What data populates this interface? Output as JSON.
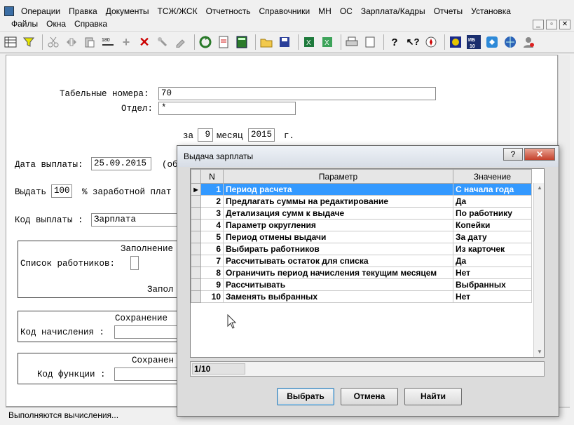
{
  "menubar": {
    "row1": [
      "Операции",
      "Правка",
      "Документы",
      "ТСЖ/ЖСК",
      "Отчетность",
      "Справочники",
      "МН",
      "ОС",
      "Зарплата/Кадры",
      "Отчеты",
      "Установка"
    ],
    "row2": [
      "Файлы",
      "Окна",
      "Справка"
    ],
    "window_controls": [
      "_",
      "▫",
      "✕"
    ]
  },
  "toolbar": {
    "icons": [
      "grid-icon",
      "filter-icon",
      "cut-icon",
      "move-icon",
      "paste-icon",
      "rotate-180-icon",
      "add-icon",
      "delete-icon",
      "tool-icon",
      "edit-icon",
      "refresh-icon",
      "export-icon",
      "calculator-icon",
      "open-folder-icon",
      "save-icon",
      "excel-icon",
      "excel-export-icon",
      "print-icon",
      "document-icon",
      "help-icon",
      "whats-this-icon",
      "compass-icon",
      "teamviewer-icon",
      "ib-icon",
      "support-icon",
      "globe-icon",
      "user-icon"
    ],
    "ib_label": "ИБ 10"
  },
  "form": {
    "tab_numbers_label": "Табельные номера:",
    "tab_numbers_value": "70",
    "department_label": "Отдел:",
    "department_value": "*",
    "period_prefix": "за",
    "month_value": "9",
    "month_label": "месяц",
    "year_value": "2015",
    "year_suffix": "г.",
    "pay_date_label": "Дата выплаты:",
    "pay_date_value": "25.09.2015",
    "pay_date_note": "(об",
    "issue_label": "Выдать",
    "issue_value": "100",
    "issue_suffix": "% заработной плат",
    "pay_code_label": "Код выплаты :",
    "pay_code_value": "Зарплата",
    "fill_group_title": "Заполнение",
    "employees_list_label": "Список работников:",
    "fill_group_footer": "Запол",
    "save_group_title": "Сохранение",
    "accrual_code_label": "Код начисления :",
    "save2_group_title": "Сохранен",
    "function_code_label": "Код функции :"
  },
  "status": {
    "text": "Выполняются вычисления..."
  },
  "dialog": {
    "title": "Выдача зарплаты",
    "help": "?",
    "close": "✕",
    "columns": [
      "N",
      "Параметр",
      "Значение"
    ],
    "rows": [
      {
        "n": "1",
        "param": "Период расчета",
        "value": "С начала года"
      },
      {
        "n": "2",
        "param": "Предлагать суммы на редактирование",
        "value": "Да"
      },
      {
        "n": "3",
        "param": "Детализация сумм к выдаче",
        "value": "По работнику"
      },
      {
        "n": "4",
        "param": "Параметр округления",
        "value": "Копейки"
      },
      {
        "n": "5",
        "param": "Период отмены выдачи",
        "value": "За дату"
      },
      {
        "n": "6",
        "param": "Выбирать работников",
        "value": "Из карточек"
      },
      {
        "n": "7",
        "param": "Рассчитывать остаток для списка",
        "value": "Да"
      },
      {
        "n": "8",
        "param": "Ограничить период начисления текущим месяцем",
        "value": "Нет"
      },
      {
        "n": "9",
        "param": "Рассчитывать",
        "value": "Выбранных"
      },
      {
        "n": "10",
        "param": "Заменять выбранных",
        "value": "Нет"
      }
    ],
    "counter": "1/10",
    "btn_select": "Выбрать",
    "btn_cancel": "Отмена",
    "btn_find": "Найти"
  }
}
